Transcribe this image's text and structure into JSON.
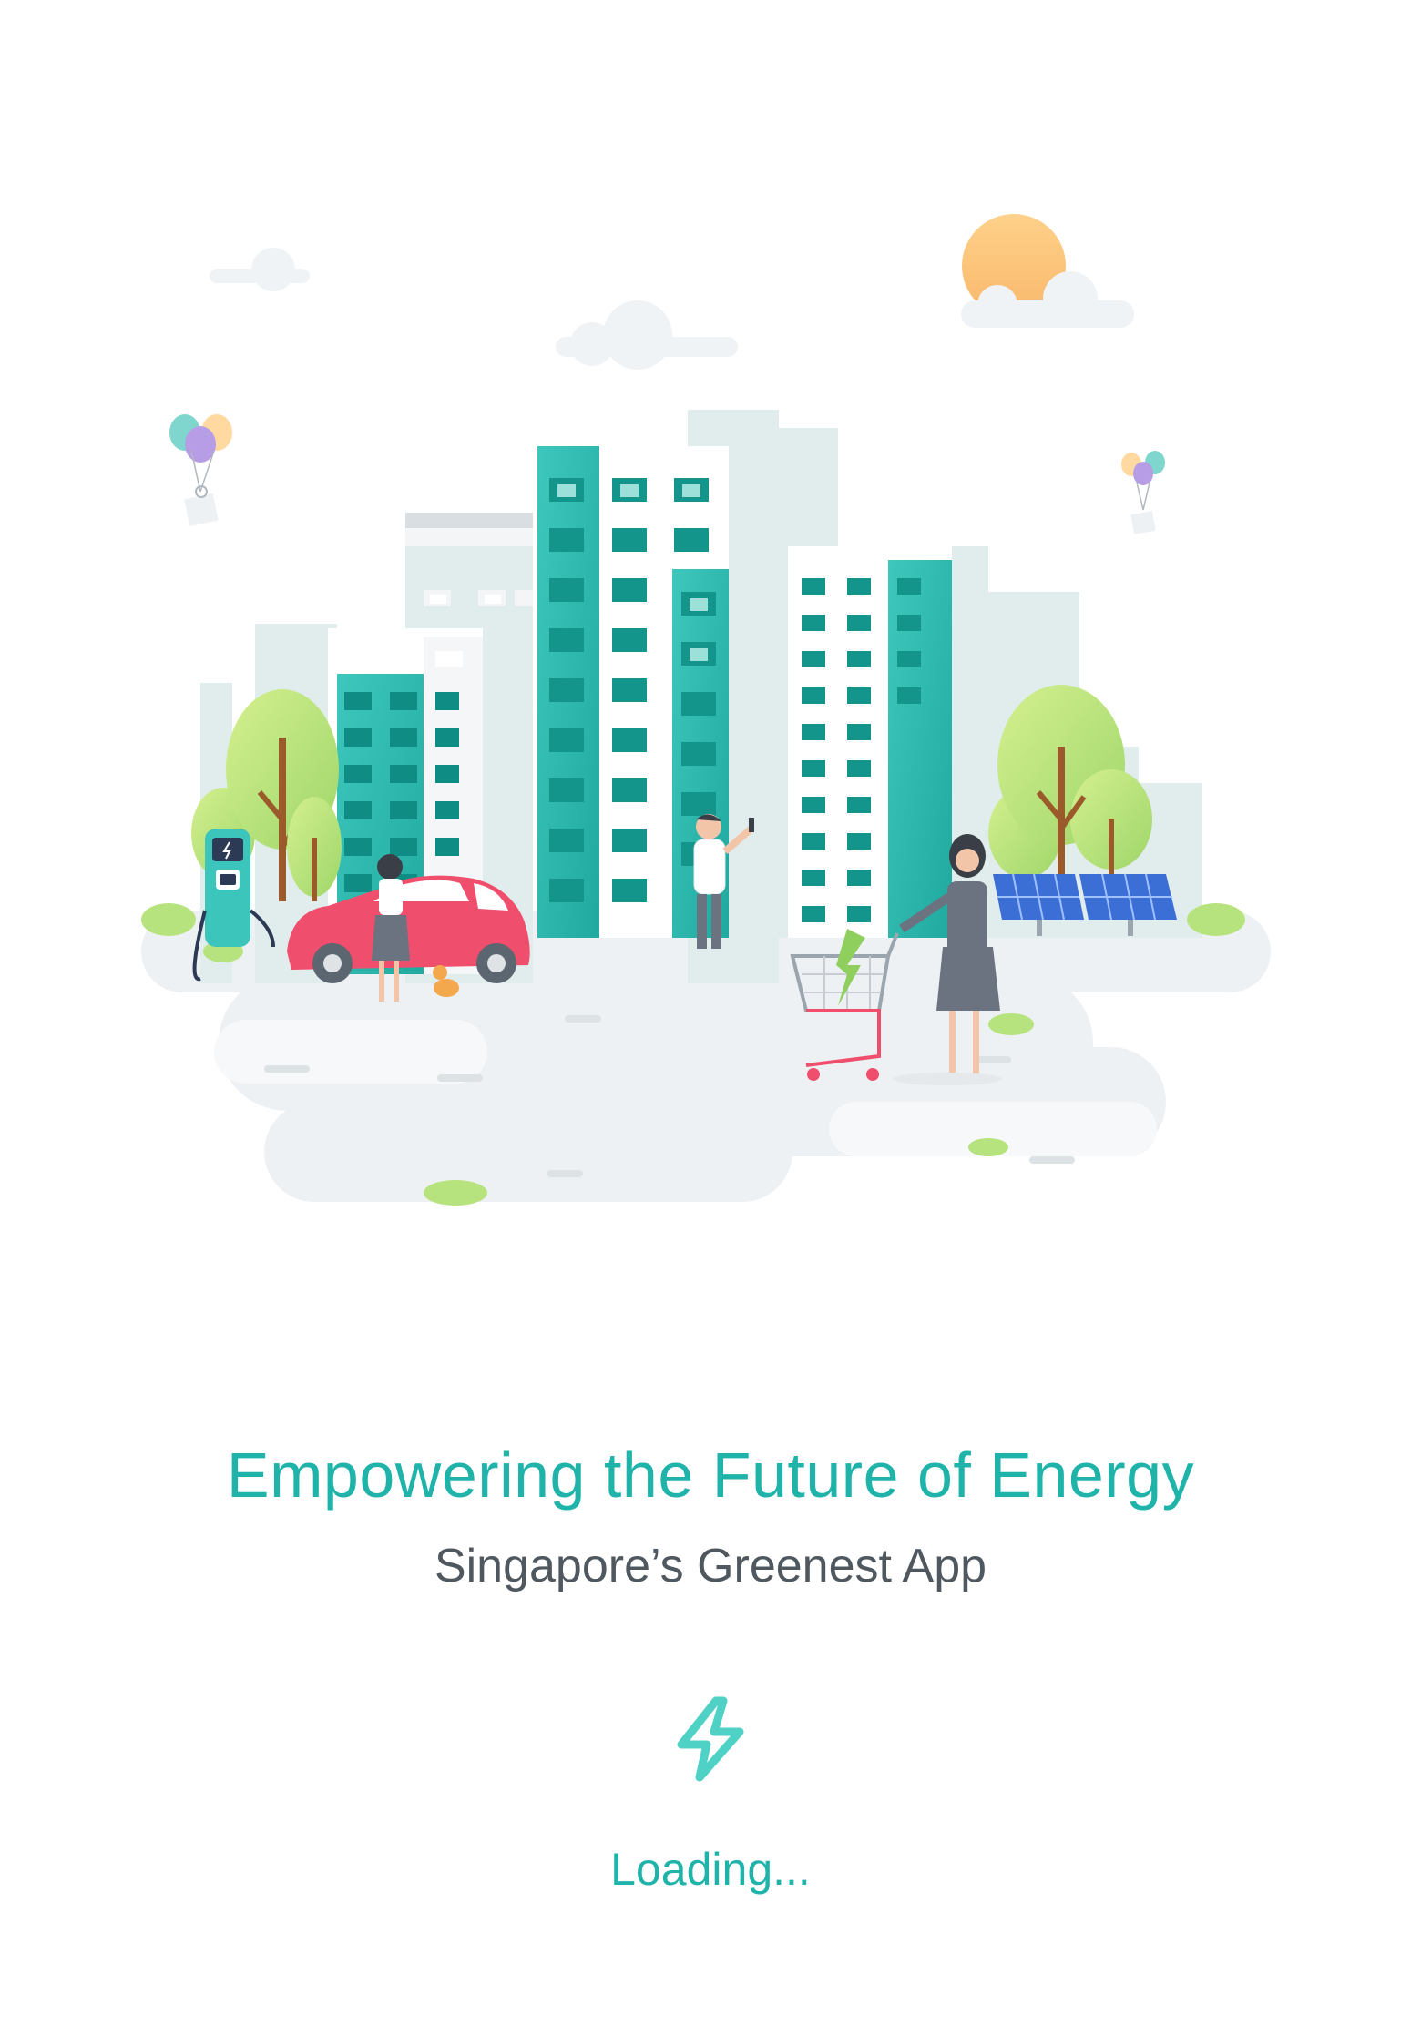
{
  "splash": {
    "headline": "Empowering the Future of Energy",
    "subheadline": "Singapore’s Greenest App",
    "loading_label": "Loading..."
  },
  "icons": {
    "loader": "lightning-bolt-icon"
  },
  "colors": {
    "brand_teal": "#1fb3aa",
    "subtitle_gray": "#50585f",
    "car_pink": "#ef4f6d",
    "sun_orange": "#fbc77e",
    "tree_green": "#b6e37d"
  }
}
